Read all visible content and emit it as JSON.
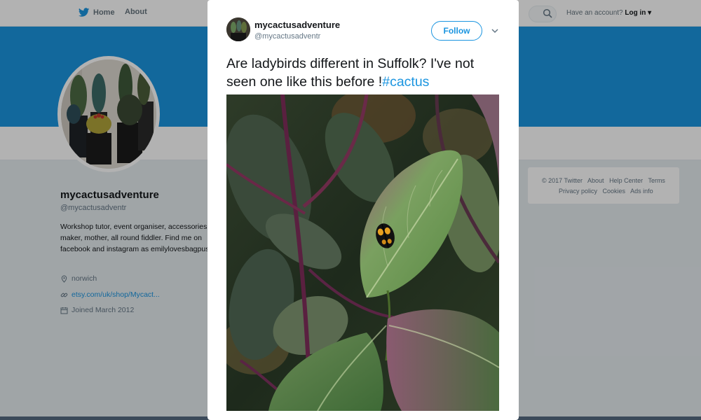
{
  "topnav": {
    "home_label": "Home",
    "about_label": "About",
    "account_text": "Have an account?",
    "login_label": "Log in"
  },
  "profile": {
    "name": "mycactusadventure",
    "handle": "@mycactusadventr",
    "bio": "Workshop tutor, event organiser, accessories maker, mother, all round fiddler. Find me on facebook and instagram as emilylovesbagpuss.",
    "location": "norwich",
    "website": "etsy.com/uk/shop/Mycact...",
    "joined": "Joined March 2012"
  },
  "footer": {
    "links_row1": [
      "© 2017 Twitter",
      "About",
      "Help Center",
      "Terms"
    ],
    "links_row2": [
      "Privacy policy",
      "Cookies",
      "Ads info"
    ]
  },
  "tweet": {
    "name": "mycactusadventure",
    "handle": "@mycactusadventr",
    "follow_label": "Follow",
    "text": "Are ladybirds different in Suffolk? I've not seen one like this before !",
    "hashtag": "#cactus"
  },
  "icons": {
    "bird": "twitter-bird-icon",
    "search": "search-icon",
    "location": "location-pin-icon",
    "link": "link-icon",
    "calendar": "calendar-icon",
    "chevron": "chevron-down-icon"
  },
  "colors": {
    "brand_blue": "#1b95e0",
    "banner": "#1b95e0",
    "page_bg": "#e6ecf0",
    "text": "#14171a",
    "muted": "#657786"
  }
}
